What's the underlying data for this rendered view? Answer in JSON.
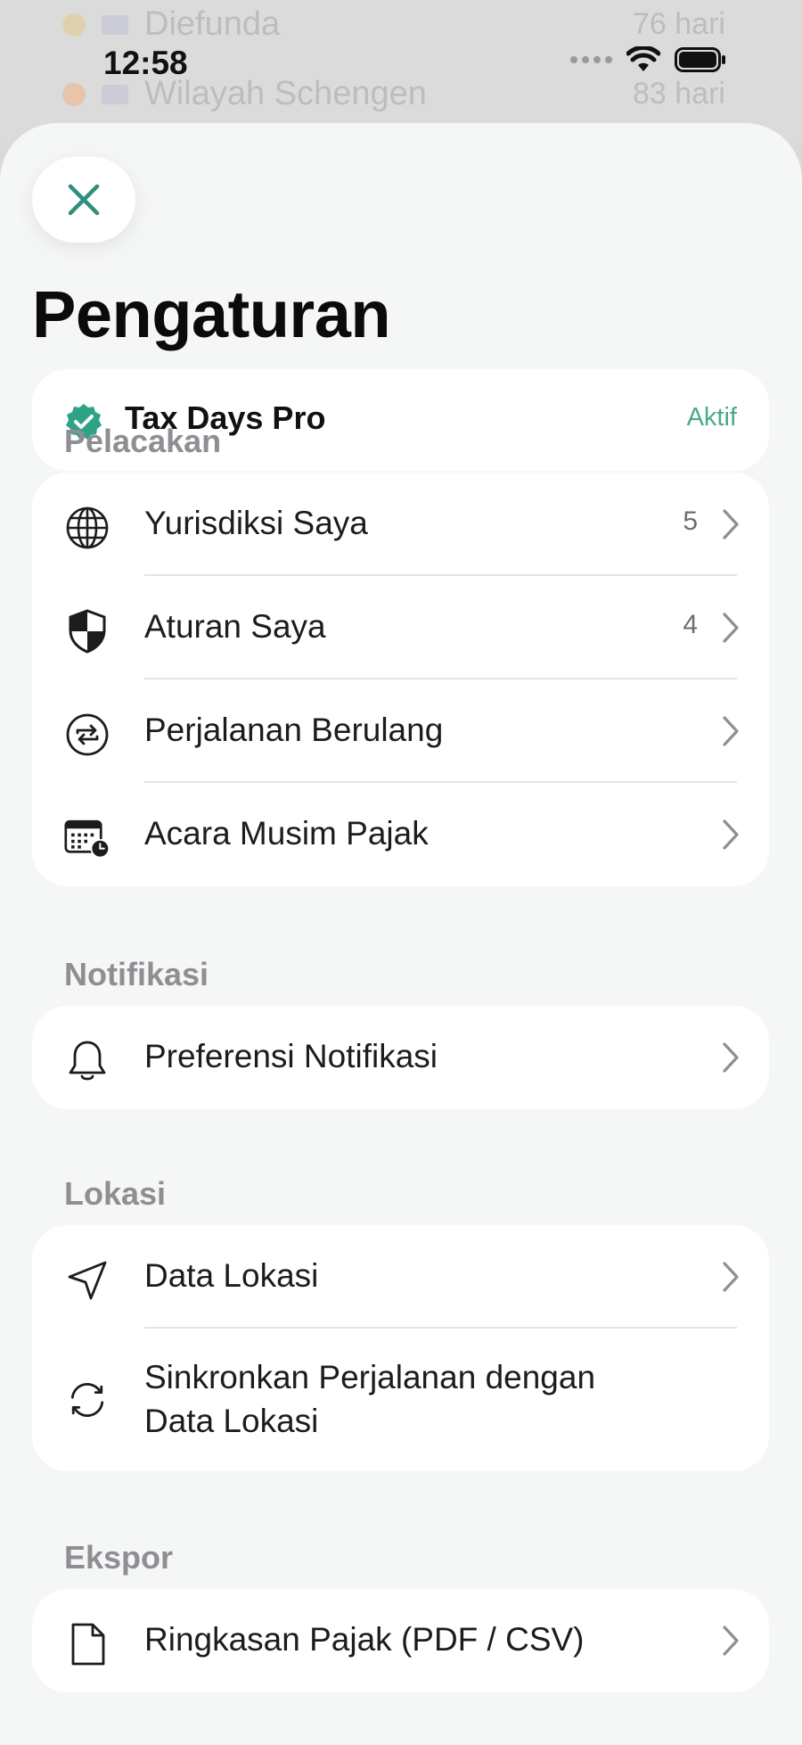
{
  "background": {
    "row1": {
      "text": "Diefunda",
      "right": "76 hari"
    },
    "row2": {
      "text": "Wilayah Schengen",
      "right": "83 hari"
    }
  },
  "status_bar": {
    "time": "12:58"
  },
  "sheet": {
    "close_icon": "close-icon",
    "title": "Pengaturan",
    "pro": {
      "name": "Tax Days Pro",
      "status": "Aktif",
      "accent": "#3aa58a"
    },
    "sections": {
      "tracking": {
        "header": "Pelacakan",
        "items": [
          {
            "label": "Yurisdiksi Saya",
            "count": "5",
            "icon": "globe-icon"
          },
          {
            "label": "Aturan Saya",
            "count": "4",
            "icon": "shield-icon"
          },
          {
            "label": "Perjalanan Berulang",
            "icon": "repeat-icon"
          },
          {
            "label": "Acara Musim Pajak",
            "icon": "calendar-clock-icon"
          }
        ]
      },
      "notifications": {
        "header": "Notifikasi",
        "items": [
          {
            "label": "Preferensi Notifikasi",
            "icon": "bell-icon"
          }
        ]
      },
      "location": {
        "header": "Lokasi",
        "items": [
          {
            "label": "Data Lokasi",
            "icon": "location-arrow-icon"
          },
          {
            "label": "Sinkronkan Perjalanan dengan Data Lokasi",
            "icon": "sync-icon"
          }
        ]
      },
      "export": {
        "header": "Ekspor",
        "items": [
          {
            "label": "Ringkasan Pajak (PDF / CSV)",
            "icon": "document-icon"
          }
        ]
      }
    }
  }
}
